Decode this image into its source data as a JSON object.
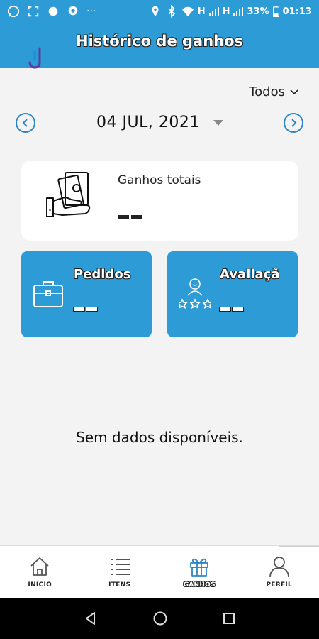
{
  "status_bar": {
    "battery": "33%",
    "time": "01:13",
    "network_1": "H",
    "network_2": "H"
  },
  "header": {
    "title": "Histórico de ganhos"
  },
  "filter": {
    "label": "Todos"
  },
  "date_nav": {
    "date": "04 JUL, 2021"
  },
  "total_card": {
    "label": "Ganhos totais",
    "value_placeholder": "--"
  },
  "stats": {
    "orders": {
      "label": "Pedidos",
      "value_placeholder": "--"
    },
    "rating": {
      "label": "Avaliaçã",
      "value_placeholder": "--"
    }
  },
  "empty_message": "Sem dados disponíveis.",
  "bottom_nav": {
    "items": [
      {
        "label": "INÍCIO",
        "icon": "home-icon"
      },
      {
        "label": "ITENS",
        "icon": "list-icon"
      },
      {
        "label": "GANHOS",
        "icon": "gift-icon",
        "active": true
      },
      {
        "label": "PERFIL",
        "icon": "user-icon"
      }
    ]
  },
  "colors": {
    "primary": "#2c9bd6",
    "background": "#f3f3f3",
    "card": "#ffffff",
    "active_icon": "#2c86c4"
  }
}
